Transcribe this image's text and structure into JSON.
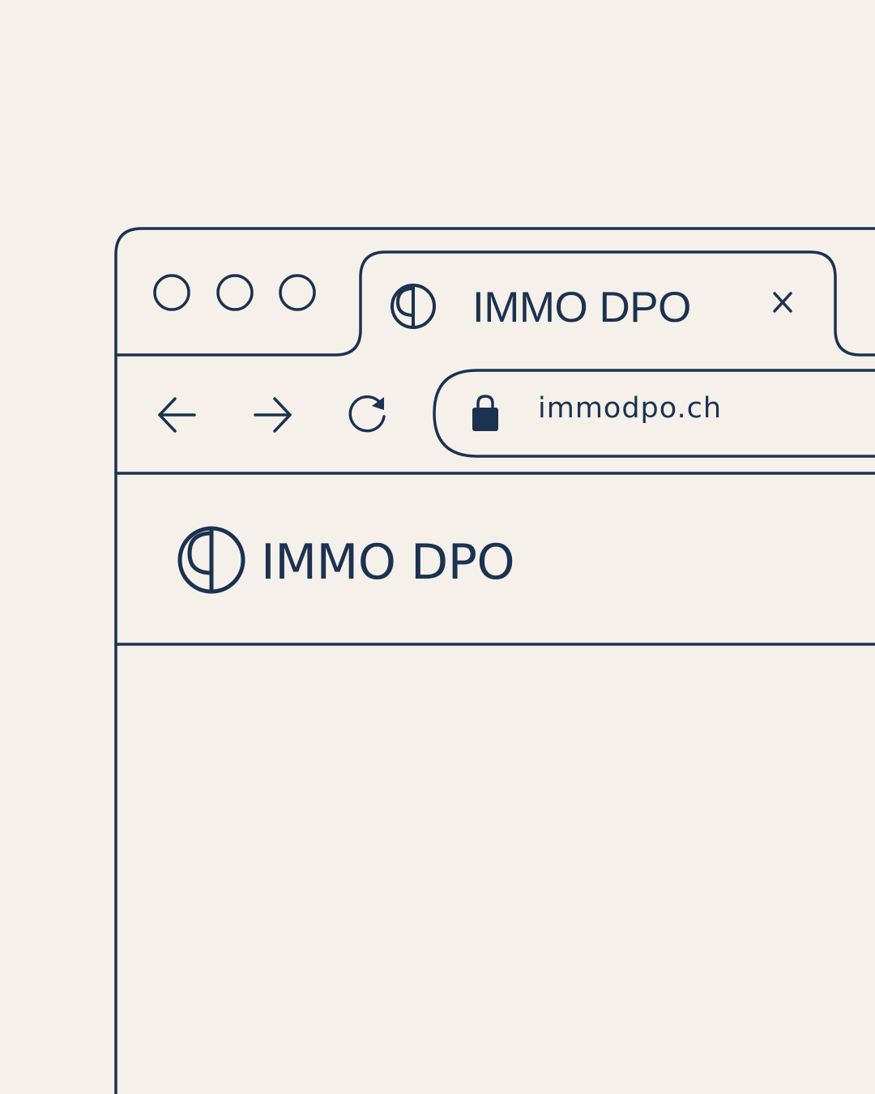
{
  "colors": {
    "background": "#f5f0ea",
    "ink": "#1b3250"
  },
  "window_controls": {
    "icons": [
      "circle-icon",
      "circle-icon",
      "circle-icon"
    ]
  },
  "tab": {
    "favicon": "globe-logo-icon",
    "title": "IMMO DPO",
    "close_icon": "close-icon"
  },
  "toolbar": {
    "back_icon": "arrow-left-icon",
    "forward_icon": "arrow-right-icon",
    "reload_icon": "reload-icon"
  },
  "address_bar": {
    "lock_icon": "lock-icon",
    "url": "immodpo.ch"
  },
  "page": {
    "brand_logo_icon": "globe-logo-icon",
    "brand_name": "IMMO DPO"
  }
}
